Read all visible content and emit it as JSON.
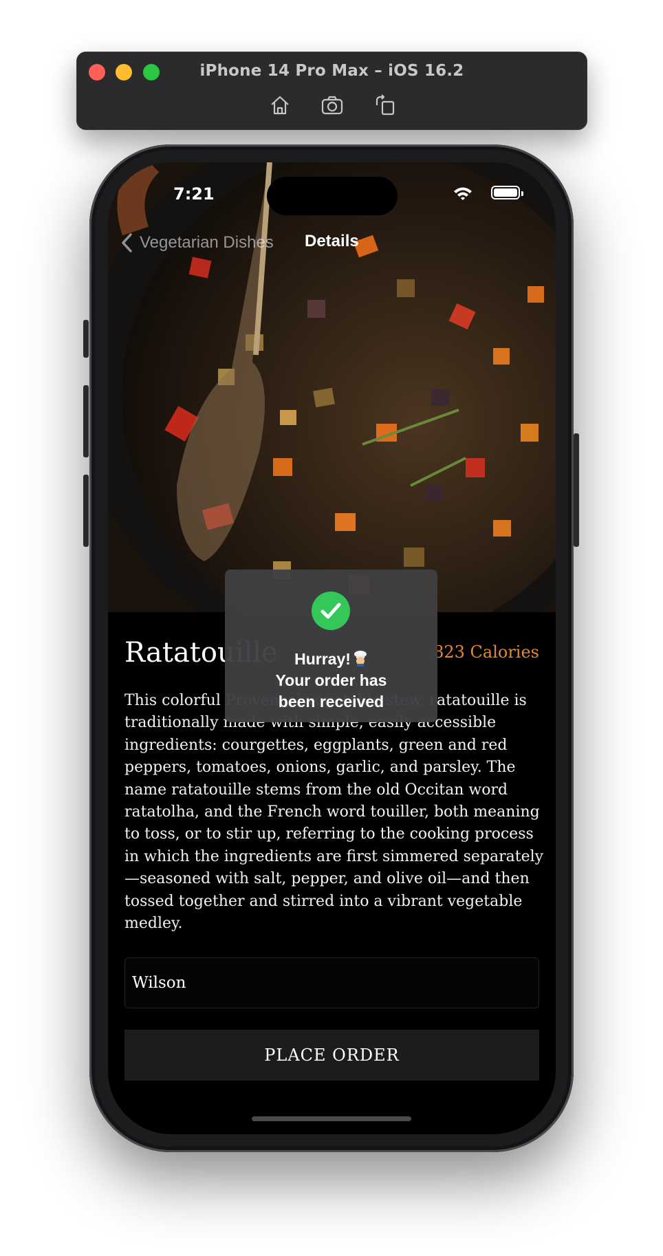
{
  "simulator": {
    "title": "iPhone 14 Pro Max – iOS 16.2",
    "tools": [
      {
        "name": "home-icon"
      },
      {
        "name": "screenshot-icon"
      },
      {
        "name": "rotate-icon"
      }
    ]
  },
  "status_bar": {
    "time": "7:21"
  },
  "nav": {
    "back_label": "Vegetarian Dishes",
    "title": "Details"
  },
  "dish": {
    "title": "Ratatouille",
    "calories": "823 Calories",
    "description": "This colorful Provençal vegetable stew, ratatouille is traditionally made with simple, easily accessible ingredients: courgettes, eggplants, green and red peppers, tomatoes, onions, garlic, and parsley. The name ratatouille stems from the old Occitan word ratatolha, and the French word touiller, both meaning to toss, or to stir up, referring to the cooking process in which the ingredients are first simmered separately—seasoned with salt, pepper, and olive oil—and then tossed together and stirred into a vibrant vegetable medley."
  },
  "order": {
    "name_value": "Wilson",
    "button_label": "PLACE ORDER"
  },
  "toast": {
    "line1": "Hurray!",
    "line2": "Your order has",
    "line3": "been received",
    "icon": "chef-emoji"
  },
  "colors": {
    "accent": "#e5892f",
    "success": "#34c759"
  }
}
